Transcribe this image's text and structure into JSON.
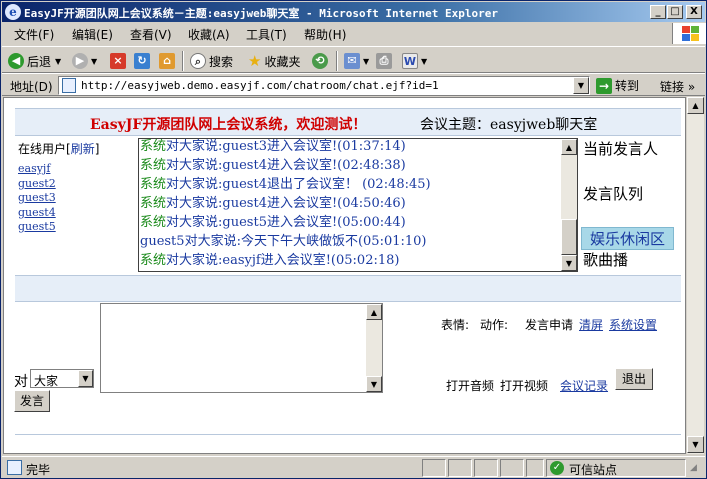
{
  "window": {
    "title": "EasyJF开源团队网上会议系统－主题:easyjweb聊天室 - Microsoft Internet Explorer",
    "minimize": "_",
    "maximize": "□",
    "close": "X"
  },
  "menu": [
    "文件(F)",
    "编辑(E)",
    "查看(V)",
    "收藏(A)",
    "工具(T)",
    "帮助(H)"
  ],
  "toolbar": {
    "back": "后退",
    "search": "搜索",
    "favorites": "收藏夹"
  },
  "address": {
    "label": "地址(D)",
    "url": "http://easyjweb.demo.easyjf.com/chatroom/chat.ejf?id=1",
    "go": "转到",
    "links": "链接 »"
  },
  "header": {
    "title": "EasyJF开源团队网上会议系统，欢迎测试！",
    "topic": "会议主题：easyjweb聊天室"
  },
  "online": {
    "label": "在线用户",
    "refresh": "刷新",
    "users": [
      "easyjf",
      "guest2",
      "guest3",
      "guest4",
      "guest5"
    ]
  },
  "chat": {
    "lines": [
      {
        "speaker": "系统",
        "to": "对大家说:",
        "text": "guest3进入会议室!(01:37:14)"
      },
      {
        "speaker": "系统",
        "to": "对大家说:",
        "text": "guest4进入会议室!(02:48:38)"
      },
      {
        "speaker": "系统",
        "to": "对大家说:",
        "text": "guest4退出了会议室！ (02:48:45)"
      },
      {
        "speaker": "系统",
        "to": "对大家说:",
        "text": "guest4进入会议室!(04:50:46)"
      },
      {
        "speaker": "系统",
        "to": "对大家说:",
        "text": "guest5进入会议室!(05:00:44)"
      },
      {
        "speaker": "guest5",
        "to": "对大家说:",
        "text": "今天下午大峡做饭不(05:01:10)"
      },
      {
        "speaker": "系统",
        "to": "对大家说:",
        "text": "easyjf进入会议室!(05:02:18)"
      }
    ]
  },
  "right_panel": {
    "current_speaker": "当前发言人",
    "queue": "发言队列",
    "leisure": "娱乐休闲区",
    "song": "歌曲播"
  },
  "controls": {
    "emotion": "表情:",
    "action": "动作:",
    "apply": "发言申请",
    "clear": "清屏",
    "settings": "系统设置",
    "to_label": "对",
    "target": "大家",
    "send": "发言",
    "audio": "打开音频",
    "video": "打开视频",
    "record": "会议记录",
    "exit": "退出"
  },
  "status": {
    "text": "完毕",
    "zone": "可信站点"
  }
}
